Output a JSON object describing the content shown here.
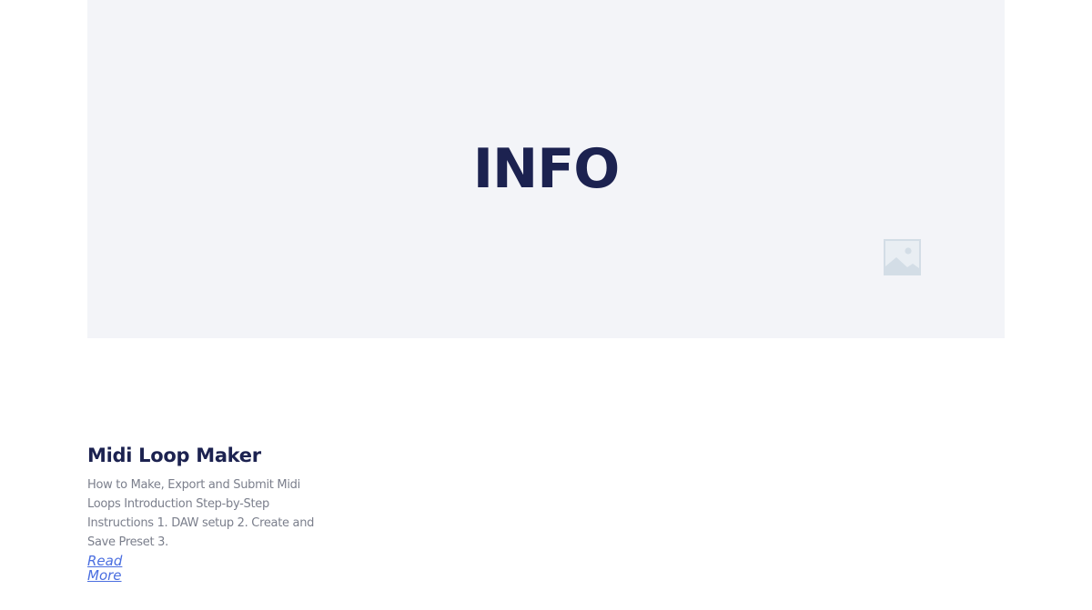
{
  "hero": {
    "title": "INFO",
    "image_icon": "image-placeholder-icon"
  },
  "post": {
    "title": "Midi Loop Maker",
    "excerpt": "How to Make, Export and Submit Midi Loops Introduction Step-by-Step Instructions 1. DAW setup 2. Create and Save Preset 3.",
    "read_more": "Read More"
  },
  "colors": {
    "hero_background": "#f3f4f8",
    "title": "#1c2250",
    "excerpt": "#7b7f8c",
    "link": "#4a6ee0",
    "placeholder_icon": "#d3dde6"
  }
}
